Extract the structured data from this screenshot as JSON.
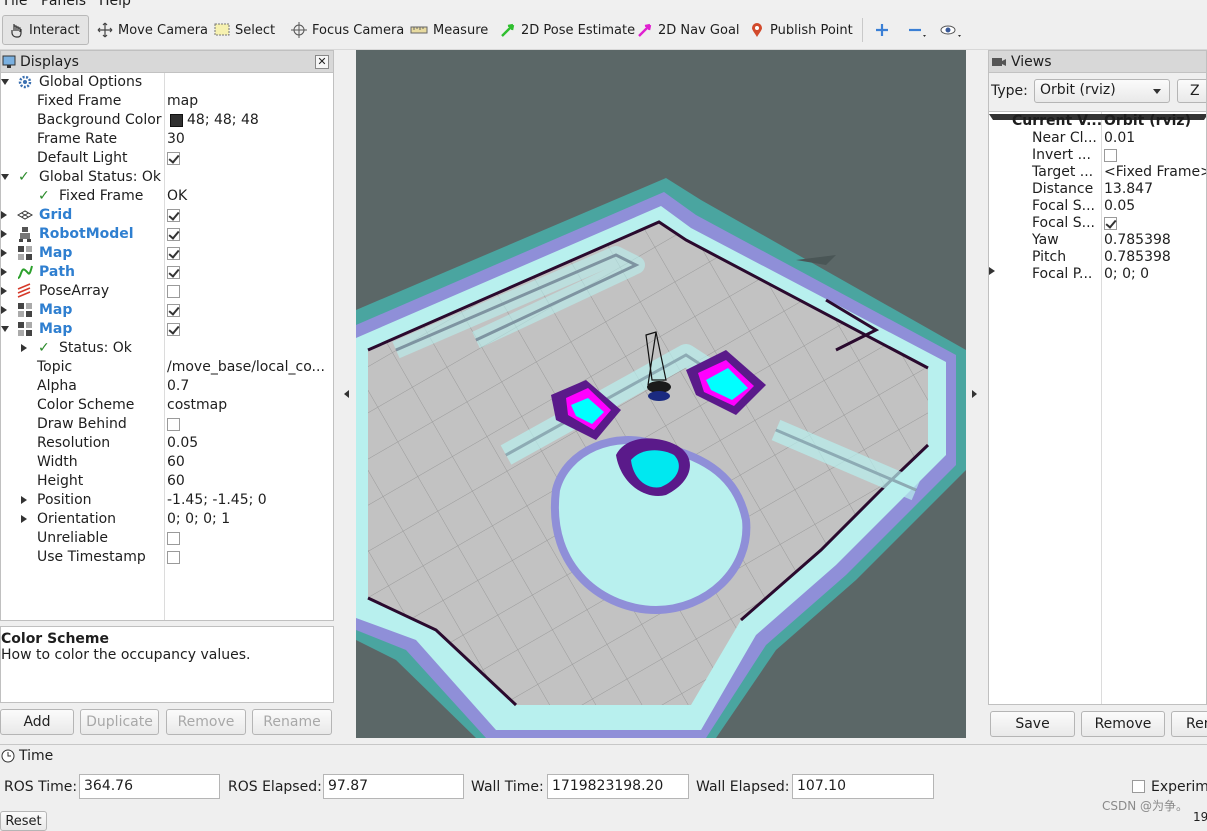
{
  "menu": {
    "file": "File",
    "panels": "Panels",
    "help": "Help"
  },
  "toolbar": {
    "interact": "Interact",
    "move_camera": "Move Camera",
    "select": "Select",
    "focus_camera": "Focus Camera",
    "measure": "Measure",
    "pose_estimate": "2D Pose Estimate",
    "nav_goal": "2D Nav Goal",
    "publish_point": "Publish Point"
  },
  "displays": {
    "title": "Displays",
    "rows": {
      "global_options": "Global Options",
      "fixed_frame": {
        "name": "Fixed Frame",
        "value": "map"
      },
      "background_color": {
        "name": "Background Color",
        "value": "48; 48; 48"
      },
      "frame_rate": {
        "name": "Frame Rate",
        "value": "30"
      },
      "default_light": {
        "name": "Default Light"
      },
      "global_status": "Global Status: Ok",
      "status_fixed_frame": {
        "name": "Fixed Frame",
        "value": "OK"
      },
      "grid": "Grid",
      "robot_model": "RobotModel",
      "map1": "Map",
      "path": "Path",
      "pose_array": "PoseArray",
      "map2": "Map",
      "map3": "Map",
      "status_ok": "Status: Ok",
      "topic": {
        "name": "Topic",
        "value": "/move_base/local_co..."
      },
      "alpha": {
        "name": "Alpha",
        "value": "0.7"
      },
      "color_scheme": {
        "name": "Color Scheme",
        "value": "costmap"
      },
      "draw_behind": {
        "name": "Draw Behind"
      },
      "resolution": {
        "name": "Resolution",
        "value": "0.05"
      },
      "width": {
        "name": "Width",
        "value": "60"
      },
      "height": {
        "name": "Height",
        "value": "60"
      },
      "position": {
        "name": "Position",
        "value": "-1.45; -1.45; 0"
      },
      "orientation": {
        "name": "Orientation",
        "value": "0; 0; 0; 1"
      },
      "unreliable": {
        "name": "Unreliable"
      },
      "use_timestamp": {
        "name": "Use Timestamp"
      }
    }
  },
  "description": {
    "title": "Color Scheme",
    "text": "How to color the occupancy values."
  },
  "display_buttons": {
    "add": "Add",
    "duplicate": "Duplicate",
    "remove": "Remove",
    "rename": "Rename"
  },
  "views": {
    "title": "Views",
    "type_label": "Type:",
    "type_value": "Orbit (rviz)",
    "zero_btn": "Z",
    "current_view": {
      "name": "Current V...",
      "value": "Orbit (rviz)"
    },
    "near_clip": {
      "name": "Near Cl...",
      "value": "0.01"
    },
    "invert": {
      "name": "Invert ..."
    },
    "target": {
      "name": "Target ...",
      "value": "<Fixed Frame>"
    },
    "distance": {
      "name": "Distance",
      "value": "13.847"
    },
    "focal_shape_size": {
      "name": "Focal S...",
      "value": "0.05"
    },
    "focal_shape_fixed": {
      "name": "Focal S..."
    },
    "yaw": {
      "name": "Yaw",
      "value": "0.785398"
    },
    "pitch": {
      "name": "Pitch",
      "value": "0.785398"
    },
    "focal_point": {
      "name": "Focal P...",
      "value": "0; 0; 0"
    },
    "buttons": {
      "save": "Save",
      "remove": "Remove",
      "rename": "Ren"
    }
  },
  "time": {
    "title": "Time",
    "ros_time_label": "ROS Time:",
    "ros_time": "364.76",
    "ros_elapsed_label": "ROS Elapsed:",
    "ros_elapsed": "97.87",
    "wall_time_label": "Wall Time:",
    "wall_time": "1719823198.20",
    "wall_elapsed_label": "Wall Elapsed:",
    "wall_elapsed": "107.10",
    "experimental": "Experim",
    "reset": "Reset",
    "fps": "19",
    "watermark": "CSDN @为争。"
  },
  "colors": {
    "background_swatch": "#303030",
    "costmap_cyan": "#b8f0ee",
    "costmap_lethal": "#00ffff",
    "costmap_inscribed": "#ff00ff",
    "view_bg": "#5b6767"
  }
}
